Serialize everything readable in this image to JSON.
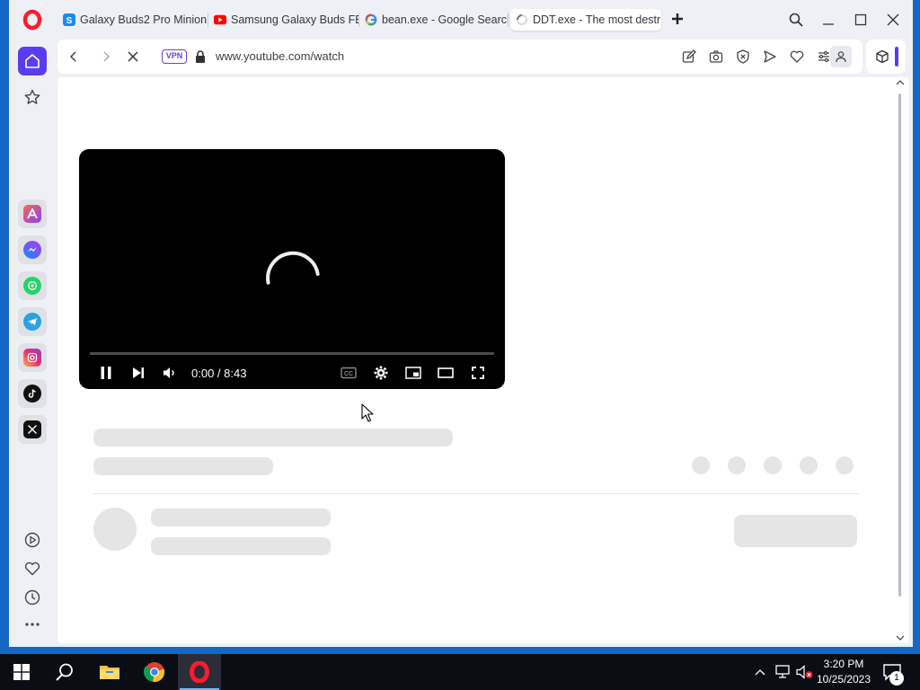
{
  "tabs": [
    {
      "title": "Galaxy Buds2 Pro Minion",
      "icon": "s-logo-icon"
    },
    {
      "title": "Samsung Galaxy Buds FE",
      "icon": "youtube-icon"
    },
    {
      "title": "bean.exe - Google Search",
      "icon": "google-icon"
    },
    {
      "title": "DDT.exe - The most destr",
      "icon": "loading-spinner-icon"
    }
  ],
  "address_bar": {
    "vpn_label": "VPN",
    "url": "www.youtube.com/watch"
  },
  "video": {
    "time": "0:00 / 8:43",
    "progress": 0
  },
  "taskbar": {
    "time": "3:20 PM",
    "date": "10/25/2023",
    "notification_count": "1"
  },
  "colors": {
    "opera_red": "#ff1b2d",
    "accent_purple": "#5a3df0",
    "desktop_blue": "#1667c4",
    "taskbar": "#0b0d15",
    "skeleton": "#e5e5e5"
  }
}
